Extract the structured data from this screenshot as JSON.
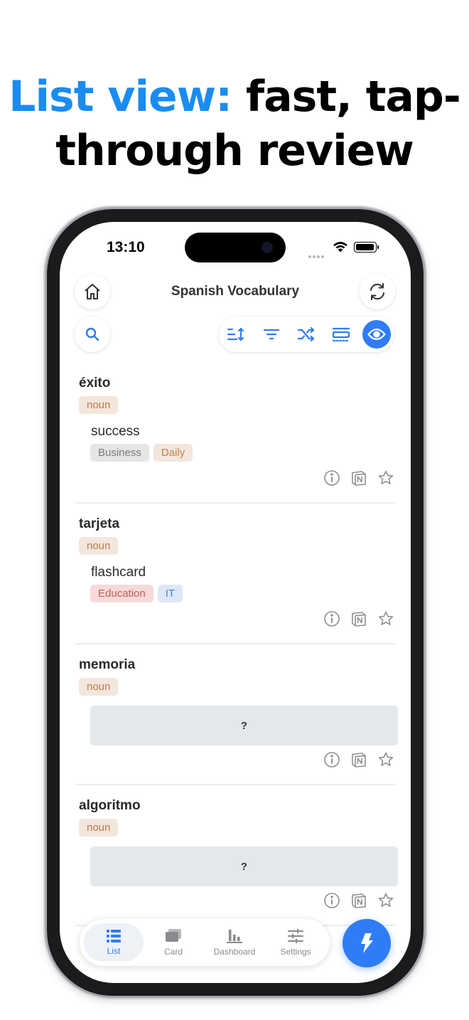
{
  "headline": {
    "accent": "List view:",
    "rest": "fast, tap-through review"
  },
  "status_bar": {
    "time": "13:10"
  },
  "header": {
    "title": "Spanish Vocabulary"
  },
  "entries": [
    {
      "term": "éxito",
      "pos": "noun",
      "meaning": "success",
      "tags": [
        "Business",
        "Daily"
      ]
    },
    {
      "term": "tarjeta",
      "pos": "noun",
      "meaning": "flashcard",
      "tags": [
        "Education",
        "IT"
      ]
    },
    {
      "term": "memoria",
      "pos": "noun",
      "hidden": "?"
    },
    {
      "term": "algoritmo",
      "pos": "noun",
      "hidden": "?"
    }
  ],
  "tabs": [
    {
      "label": "List",
      "icon": "list-icon",
      "active": true
    },
    {
      "label": "Card",
      "icon": "cards-icon"
    },
    {
      "label": "Dashboard",
      "icon": "chart-icon"
    },
    {
      "label": "Settings",
      "icon": "sliders-icon"
    }
  ],
  "colors": {
    "accent": "#2f7cf6",
    "headline_accent": "#1a8cf0"
  }
}
